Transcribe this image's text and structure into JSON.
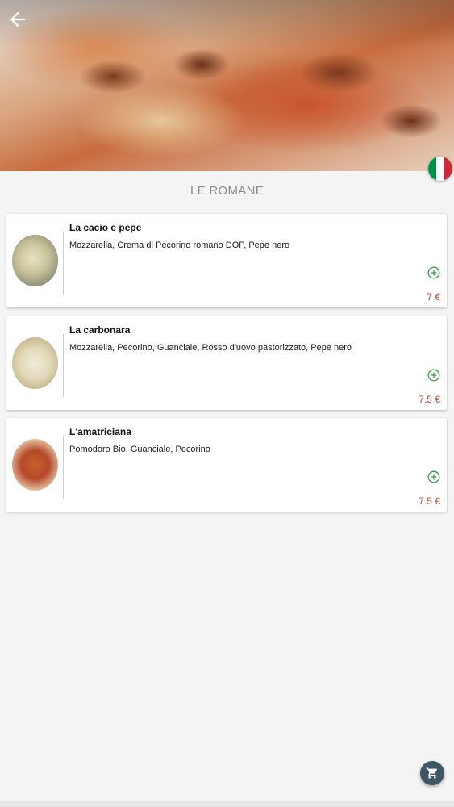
{
  "header": {
    "back_icon": "arrow-left-icon",
    "language_flag": "italy-flag-icon",
    "flag_colors": [
      "#009246",
      "#ffffff",
      "#ce2b37"
    ]
  },
  "section": {
    "title": "LE ROMANE"
  },
  "menu_items": [
    {
      "name": "La cacio e pepe",
      "description": "Mozzarella, Crema di Pecorino romano DOP, Pepe nero",
      "price": "7 €",
      "add_icon": "plus-circle-icon"
    },
    {
      "name": "La carbonara",
      "description": "Mozzarella, Pecorino, Guanciale, Rosso d'uovo pastorizzato, Pepe nero",
      "price": "7.5 €",
      "add_icon": "plus-circle-icon"
    },
    {
      "name": "L'amatriciana",
      "description": "Pomodoro Bio, Guanciale, Pecorino",
      "price": "7.5 €",
      "add_icon": "plus-circle-icon"
    }
  ],
  "cart": {
    "icon": "shopping-cart-icon"
  },
  "colors": {
    "price": "#b44a3a",
    "add_icon": "#3a9a4a",
    "cart_button": "#3f5663"
  }
}
